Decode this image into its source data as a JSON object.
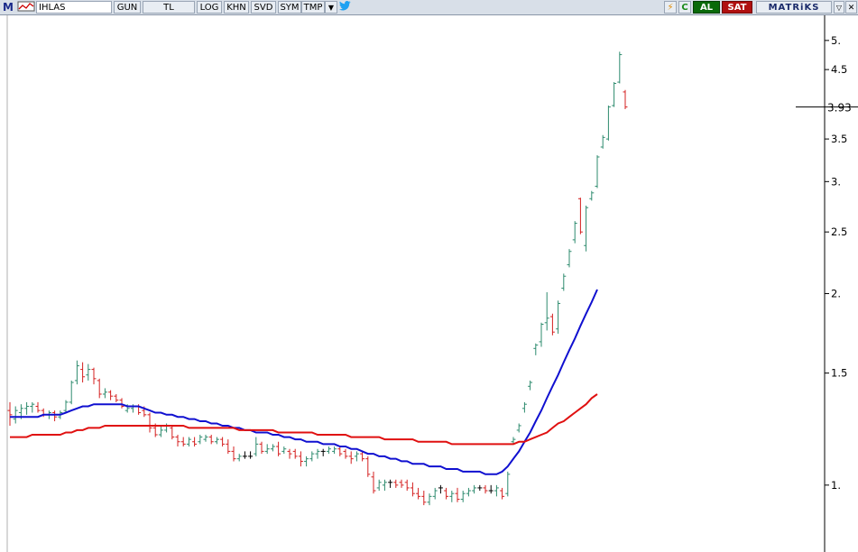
{
  "toolbar": {
    "m_label": "M",
    "symbol": "IHLAS",
    "period": "GUN",
    "currency": "TL",
    "log": "LOG",
    "khn": "KHN",
    "svd": "SVD",
    "sym": "SYM",
    "tmp": "TMP",
    "buy": "AL",
    "sell": "SAT",
    "brand": "MATRiKS"
  },
  "colors": {
    "up": "#2e8b6e",
    "down": "#d42020",
    "neutral": "#000000",
    "ma_fast": "#1010d0",
    "ma_slow": "#e01010",
    "toolbar_bg": "#d8dfe8"
  },
  "chart_data": {
    "type": "ohlc",
    "scale": "log",
    "ylim": [
      0.88,
      5.3
    ],
    "y_ticks": [
      "5.",
      "4.5",
      "3.5",
      "3.",
      "2.5",
      "2.",
      "1.5",
      "1."
    ],
    "y_tick_values": [
      5,
      4.5,
      3.5,
      3,
      2.5,
      2,
      1.5,
      1
    ],
    "last_price": "3.93",
    "last_price_value": 3.93,
    "bars": [
      {
        "o": 1.31,
        "h": 1.35,
        "l": 1.24,
        "c": 1.29
      },
      {
        "o": 1.27,
        "h": 1.33,
        "l": 1.25,
        "c": 1.31
      },
      {
        "o": 1.3,
        "h": 1.34,
        "l": 1.27,
        "c": 1.32
      },
      {
        "o": 1.32,
        "h": 1.35,
        "l": 1.29,
        "c": 1.33
      },
      {
        "o": 1.33,
        "h": 1.35,
        "l": 1.3,
        "c": 1.34
      },
      {
        "o": 1.33,
        "h": 1.35,
        "l": 1.3,
        "c": 1.31
      },
      {
        "o": 1.31,
        "h": 1.32,
        "l": 1.28,
        "c": 1.29
      },
      {
        "o": 1.29,
        "h": 1.31,
        "l": 1.27,
        "c": 1.3
      },
      {
        "o": 1.3,
        "h": 1.31,
        "l": 1.26,
        "c": 1.28
      },
      {
        "o": 1.28,
        "h": 1.31,
        "l": 1.27,
        "c": 1.3
      },
      {
        "o": 1.31,
        "h": 1.36,
        "l": 1.3,
        "c": 1.35
      },
      {
        "o": 1.35,
        "h": 1.46,
        "l": 1.34,
        "c": 1.45
      },
      {
        "o": 1.46,
        "h": 1.57,
        "l": 1.44,
        "c": 1.54
      },
      {
        "o": 1.52,
        "h": 1.56,
        "l": 1.45,
        "c": 1.48
      },
      {
        "o": 1.49,
        "h": 1.55,
        "l": 1.46,
        "c": 1.52
      },
      {
        "o": 1.52,
        "h": 1.53,
        "l": 1.44,
        "c": 1.47
      },
      {
        "o": 1.46,
        "h": 1.47,
        "l": 1.37,
        "c": 1.39
      },
      {
        "o": 1.39,
        "h": 1.42,
        "l": 1.37,
        "c": 1.4
      },
      {
        "o": 1.4,
        "h": 1.41,
        "l": 1.36,
        "c": 1.38
      },
      {
        "o": 1.38,
        "h": 1.39,
        "l": 1.35,
        "c": 1.36
      },
      {
        "o": 1.36,
        "h": 1.37,
        "l": 1.32,
        "c": 1.33
      },
      {
        "o": 1.31,
        "h": 1.34,
        "l": 1.3,
        "c": 1.32
      },
      {
        "o": 1.32,
        "h": 1.34,
        "l": 1.3,
        "c": 1.33
      },
      {
        "o": 1.33,
        "h": 1.34,
        "l": 1.29,
        "c": 1.3
      },
      {
        "o": 1.31,
        "h": 1.33,
        "l": 1.28,
        "c": 1.29
      },
      {
        "o": 1.29,
        "h": 1.3,
        "l": 1.21,
        "c": 1.23
      },
      {
        "o": 1.23,
        "h": 1.25,
        "l": 1.19,
        "c": 1.2
      },
      {
        "o": 1.2,
        "h": 1.24,
        "l": 1.19,
        "c": 1.22
      },
      {
        "o": 1.22,
        "h": 1.25,
        "l": 1.21,
        "c": 1.24
      },
      {
        "o": 1.23,
        "h": 1.24,
        "l": 1.18,
        "c": 1.19
      },
      {
        "o": 1.19,
        "h": 1.2,
        "l": 1.15,
        "c": 1.17
      },
      {
        "o": 1.17,
        "h": 1.19,
        "l": 1.15,
        "c": 1.16
      },
      {
        "o": 1.16,
        "h": 1.19,
        "l": 1.15,
        "c": 1.18
      },
      {
        "o": 1.17,
        "h": 1.19,
        "l": 1.15,
        "c": 1.16
      },
      {
        "o": 1.17,
        "h": 1.2,
        "l": 1.16,
        "c": 1.19
      },
      {
        "o": 1.18,
        "h": 1.2,
        "l": 1.17,
        "c": 1.19
      },
      {
        "o": 1.19,
        "h": 1.2,
        "l": 1.16,
        "c": 1.17
      },
      {
        "o": 1.17,
        "h": 1.19,
        "l": 1.16,
        "c": 1.18
      },
      {
        "o": 1.18,
        "h": 1.19,
        "l": 1.15,
        "c": 1.16
      },
      {
        "o": 1.16,
        "h": 1.18,
        "l": 1.12,
        "c": 1.13
      },
      {
        "o": 1.13,
        "h": 1.15,
        "l": 1.09,
        "c": 1.1
      },
      {
        "o": 1.1,
        "h": 1.12,
        "l": 1.09,
        "c": 1.11
      },
      {
        "o": 1.11,
        "h": 1.13,
        "l": 1.1,
        "c": 1.11
      },
      {
        "o": 1.11,
        "h": 1.13,
        "l": 1.1,
        "c": 1.11
      },
      {
        "o": 1.12,
        "h": 1.19,
        "l": 1.11,
        "c": 1.16
      },
      {
        "o": 1.16,
        "h": 1.17,
        "l": 1.12,
        "c": 1.13
      },
      {
        "o": 1.13,
        "h": 1.16,
        "l": 1.12,
        "c": 1.14
      },
      {
        "o": 1.14,
        "h": 1.16,
        "l": 1.13,
        "c": 1.15
      },
      {
        "o": 1.15,
        "h": 1.17,
        "l": 1.11,
        "c": 1.12
      },
      {
        "o": 1.13,
        "h": 1.15,
        "l": 1.12,
        "c": 1.14
      },
      {
        "o": 1.13,
        "h": 1.14,
        "l": 1.1,
        "c": 1.12
      },
      {
        "o": 1.13,
        "h": 1.14,
        "l": 1.1,
        "c": 1.11
      },
      {
        "o": 1.11,
        "h": 1.13,
        "l": 1.07,
        "c": 1.09
      },
      {
        "o": 1.09,
        "h": 1.11,
        "l": 1.07,
        "c": 1.1
      },
      {
        "o": 1.1,
        "h": 1.13,
        "l": 1.09,
        "c": 1.12
      },
      {
        "o": 1.12,
        "h": 1.14,
        "l": 1.1,
        "c": 1.13
      },
      {
        "o": 1.13,
        "h": 1.14,
        "l": 1.11,
        "c": 1.13
      },
      {
        "o": 1.13,
        "h": 1.15,
        "l": 1.12,
        "c": 1.14
      },
      {
        "o": 1.13,
        "h": 1.15,
        "l": 1.12,
        "c": 1.14
      },
      {
        "o": 1.14,
        "h": 1.15,
        "l": 1.11,
        "c": 1.12
      },
      {
        "o": 1.13,
        "h": 1.14,
        "l": 1.1,
        "c": 1.11
      },
      {
        "o": 1.11,
        "h": 1.13,
        "l": 1.08,
        "c": 1.1
      },
      {
        "o": 1.11,
        "h": 1.13,
        "l": 1.09,
        "c": 1.12
      },
      {
        "o": 1.12,
        "h": 1.13,
        "l": 1.09,
        "c": 1.1
      },
      {
        "o": 1.1,
        "h": 1.11,
        "l": 1.03,
        "c": 1.04
      },
      {
        "o": 1.03,
        "h": 1.05,
        "l": 0.97,
        "c": 0.98
      },
      {
        "o": 0.99,
        "h": 1.02,
        "l": 0.98,
        "c": 1.01
      },
      {
        "o": 1.0,
        "h": 1.02,
        "l": 0.98,
        "c": 1.01
      },
      {
        "o": 1.01,
        "h": 1.02,
        "l": 0.99,
        "c": 1.01
      },
      {
        "o": 1.01,
        "h": 1.02,
        "l": 0.99,
        "c": 1.0
      },
      {
        "o": 1.01,
        "h": 1.02,
        "l": 0.99,
        "c": 1.0
      },
      {
        "o": 1.01,
        "h": 1.02,
        "l": 0.98,
        "c": 0.99
      },
      {
        "o": 0.99,
        "h": 1.01,
        "l": 0.96,
        "c": 0.97
      },
      {
        "o": 0.97,
        "h": 0.99,
        "l": 0.95,
        "c": 0.96
      },
      {
        "o": 0.96,
        "h": 0.98,
        "l": 0.93,
        "c": 0.94
      },
      {
        "o": 0.94,
        "h": 0.97,
        "l": 0.93,
        "c": 0.96
      },
      {
        "o": 0.96,
        "h": 0.99,
        "l": 0.95,
        "c": 0.98
      },
      {
        "o": 0.99,
        "h": 1.0,
        "l": 0.97,
        "c": 0.99
      },
      {
        "o": 0.98,
        "h": 0.99,
        "l": 0.95,
        "c": 0.96
      },
      {
        "o": 0.96,
        "h": 0.98,
        "l": 0.94,
        "c": 0.97
      },
      {
        "o": 0.97,
        "h": 0.99,
        "l": 0.94,
        "c": 0.95
      },
      {
        "o": 0.95,
        "h": 0.98,
        "l": 0.94,
        "c": 0.97
      },
      {
        "o": 0.97,
        "h": 0.99,
        "l": 0.96,
        "c": 0.98
      },
      {
        "o": 0.98,
        "h": 1.0,
        "l": 0.97,
        "c": 0.99
      },
      {
        "o": 0.99,
        "h": 1.0,
        "l": 0.98,
        "c": 0.99
      },
      {
        "o": 0.99,
        "h": 1.0,
        "l": 0.97,
        "c": 0.98
      },
      {
        "o": 0.98,
        "h": 1.0,
        "l": 0.97,
        "c": 0.98
      },
      {
        "o": 0.98,
        "h": 1.0,
        "l": 0.96,
        "c": 0.99
      },
      {
        "o": 0.98,
        "h": 0.99,
        "l": 0.95,
        "c": 0.96
      },
      {
        "o": 0.97,
        "h": 1.05,
        "l": 0.96,
        "c": 1.04
      },
      {
        "o": 1.17,
        "h": 1.19,
        "l": 1.16,
        "c": 1.18
      },
      {
        "o": 1.22,
        "h": 1.25,
        "l": 1.21,
        "c": 1.24
      },
      {
        "o": 1.32,
        "h": 1.35,
        "l": 1.3,
        "c": 1.34
      },
      {
        "o": 1.43,
        "h": 1.46,
        "l": 1.41,
        "c": 1.45
      },
      {
        "o": 1.64,
        "h": 1.67,
        "l": 1.6,
        "c": 1.66
      },
      {
        "o": 1.68,
        "h": 1.8,
        "l": 1.65,
        "c": 1.79
      },
      {
        "o": 1.8,
        "h": 2.01,
        "l": 1.75,
        "c": 1.83
      },
      {
        "o": 1.84,
        "h": 1.86,
        "l": 1.72,
        "c": 1.74
      },
      {
        "o": 1.76,
        "h": 1.95,
        "l": 1.73,
        "c": 1.93
      },
      {
        "o": 2.04,
        "h": 2.15,
        "l": 2.02,
        "c": 2.13
      },
      {
        "o": 2.22,
        "h": 2.35,
        "l": 2.2,
        "c": 2.33
      },
      {
        "o": 2.43,
        "h": 2.6,
        "l": 2.4,
        "c": 2.58
      },
      {
        "o": 2.82,
        "h": 2.83,
        "l": 2.48,
        "c": 2.5
      },
      {
        "o": 2.38,
        "h": 2.75,
        "l": 2.33,
        "c": 2.73
      },
      {
        "o": 2.82,
        "h": 2.9,
        "l": 2.8,
        "c": 2.88
      },
      {
        "o": 2.95,
        "h": 3.3,
        "l": 2.93,
        "c": 3.28
      },
      {
        "o": 3.4,
        "h": 3.55,
        "l": 3.38,
        "c": 3.52
      },
      {
        "o": 3.5,
        "h": 3.95,
        "l": 3.48,
        "c": 3.93
      },
      {
        "o": 3.95,
        "h": 4.3,
        "l": 3.93,
        "c": 4.28
      },
      {
        "o": 4.3,
        "h": 4.8,
        "l": 4.28,
        "c": 4.75
      },
      {
        "o": 4.15,
        "h": 4.18,
        "l": 3.9,
        "c": 3.93
      }
    ],
    "series": [
      {
        "values": [
          1.28,
          1.28,
          1.28,
          1.28,
          1.28,
          1.28,
          1.29,
          1.29,
          1.29,
          1.29,
          1.3,
          1.31,
          1.32,
          1.33,
          1.33,
          1.34,
          1.34,
          1.34,
          1.34,
          1.34,
          1.34,
          1.33,
          1.33,
          1.33,
          1.32,
          1.31,
          1.3,
          1.3,
          1.29,
          1.29,
          1.28,
          1.28,
          1.27,
          1.27,
          1.26,
          1.26,
          1.25,
          1.25,
          1.24,
          1.24,
          1.23,
          1.23,
          1.22,
          1.22,
          1.21,
          1.21,
          1.21,
          1.2,
          1.2,
          1.19,
          1.19,
          1.18,
          1.18,
          1.17,
          1.17,
          1.17,
          1.16,
          1.16,
          1.16,
          1.15,
          1.15,
          1.14,
          1.14,
          1.13,
          1.12,
          1.12,
          1.11,
          1.11,
          1.1,
          1.1,
          1.09,
          1.09,
          1.08,
          1.08,
          1.08,
          1.07,
          1.07,
          1.07,
          1.06,
          1.06,
          1.06,
          1.05,
          1.05,
          1.05,
          1.05,
          1.04,
          1.04,
          1.04,
          1.05,
          1.07,
          1.1,
          1.13,
          1.17,
          1.21,
          1.26,
          1.31,
          1.37,
          1.43,
          1.49,
          1.56,
          1.63,
          1.7,
          1.78,
          1.86,
          1.94,
          2.03
        ]
      },
      {
        "values": [
          1.19,
          1.19,
          1.19,
          1.19,
          1.2,
          1.2,
          1.2,
          1.2,
          1.2,
          1.2,
          1.21,
          1.21,
          1.22,
          1.22,
          1.23,
          1.23,
          1.23,
          1.24,
          1.24,
          1.24,
          1.24,
          1.24,
          1.24,
          1.24,
          1.24,
          1.24,
          1.24,
          1.24,
          1.24,
          1.24,
          1.24,
          1.24,
          1.23,
          1.23,
          1.23,
          1.23,
          1.23,
          1.23,
          1.23,
          1.23,
          1.23,
          1.22,
          1.22,
          1.22,
          1.22,
          1.22,
          1.22,
          1.22,
          1.21,
          1.21,
          1.21,
          1.21,
          1.21,
          1.21,
          1.21,
          1.2,
          1.2,
          1.2,
          1.2,
          1.2,
          1.2,
          1.19,
          1.19,
          1.19,
          1.19,
          1.19,
          1.19,
          1.18,
          1.18,
          1.18,
          1.18,
          1.18,
          1.18,
          1.17,
          1.17,
          1.17,
          1.17,
          1.17,
          1.17,
          1.16,
          1.16,
          1.16,
          1.16,
          1.16,
          1.16,
          1.16,
          1.16,
          1.16,
          1.16,
          1.16,
          1.16,
          1.17,
          1.17,
          1.18,
          1.19,
          1.2,
          1.21,
          1.23,
          1.25,
          1.26,
          1.28,
          1.3,
          1.32,
          1.34,
          1.37,
          1.39
        ]
      }
    ]
  }
}
